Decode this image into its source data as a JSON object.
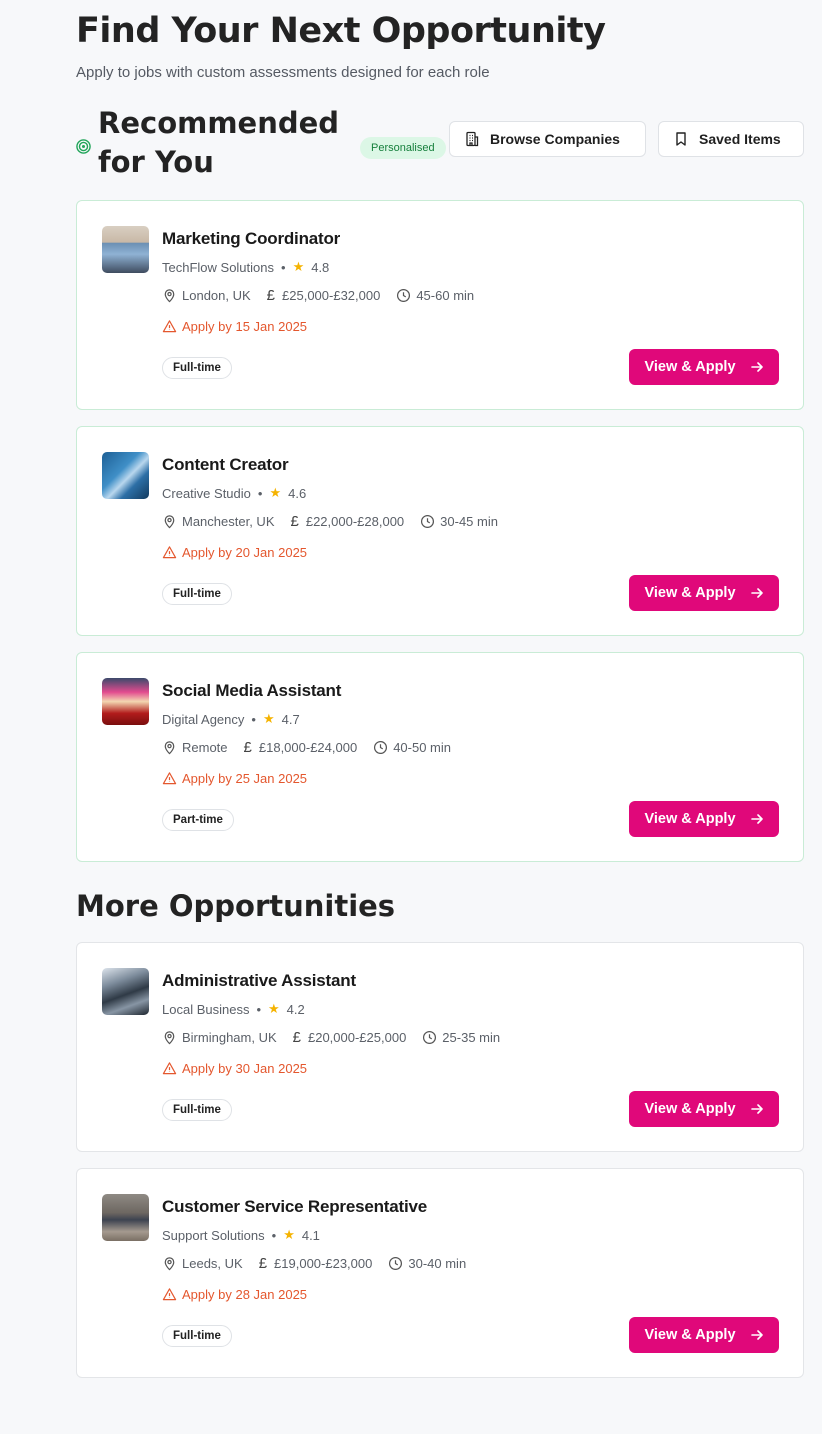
{
  "header": {
    "title": "Find Your Next Opportunity",
    "subtitle": "Apply to jobs with custom assessments designed for each role"
  },
  "recommended": {
    "title": "Recommended for You",
    "badge": "Personalised",
    "browse_label": "Browse Companies",
    "saved_label": "Saved Items",
    "jobs": [
      {
        "title": "Marketing Coordinator",
        "company": "TechFlow Solutions",
        "rating": "4.8",
        "location": "London, UK",
        "salary": "£25,000-£32,000",
        "duration": "45-60 min",
        "deadline": "Apply by 15 Jan 2025",
        "type": "Full-time",
        "apply": "View & Apply"
      },
      {
        "title": "Content Creator",
        "company": "Creative Studio",
        "rating": "4.6",
        "location": "Manchester, UK",
        "salary": "£22,000-£28,000",
        "duration": "30-45 min",
        "deadline": "Apply by 20 Jan 2025",
        "type": "Full-time",
        "apply": "View & Apply"
      },
      {
        "title": "Social Media Assistant",
        "company": "Digital Agency",
        "rating": "4.7",
        "location": "Remote",
        "salary": "£18,000-£24,000",
        "duration": "40-50 min",
        "deadline": "Apply by 25 Jan 2025",
        "type": "Part-time",
        "apply": "View & Apply"
      }
    ]
  },
  "more": {
    "title": "More Opportunities",
    "jobs": [
      {
        "title": "Administrative Assistant",
        "company": "Local Business",
        "rating": "4.2",
        "location": "Birmingham, UK",
        "salary": "£20,000-£25,000",
        "duration": "25-35 min",
        "deadline": "Apply by 30 Jan 2025",
        "type": "Full-time",
        "apply": "View & Apply"
      },
      {
        "title": "Customer Service Representative",
        "company": "Support Solutions",
        "rating": "4.1",
        "location": "Leeds, UK",
        "salary": "£19,000-£23,000",
        "duration": "30-40 min",
        "deadline": "Apply by 28 Jan 2025",
        "type": "Full-time",
        "apply": "View & Apply"
      }
    ]
  },
  "colors": {
    "accent": "#e0087a",
    "deadline": "#e4572e",
    "personalised_bg": "#dcf7e6",
    "personalised_text": "#17803d",
    "star": "#f5b301"
  }
}
